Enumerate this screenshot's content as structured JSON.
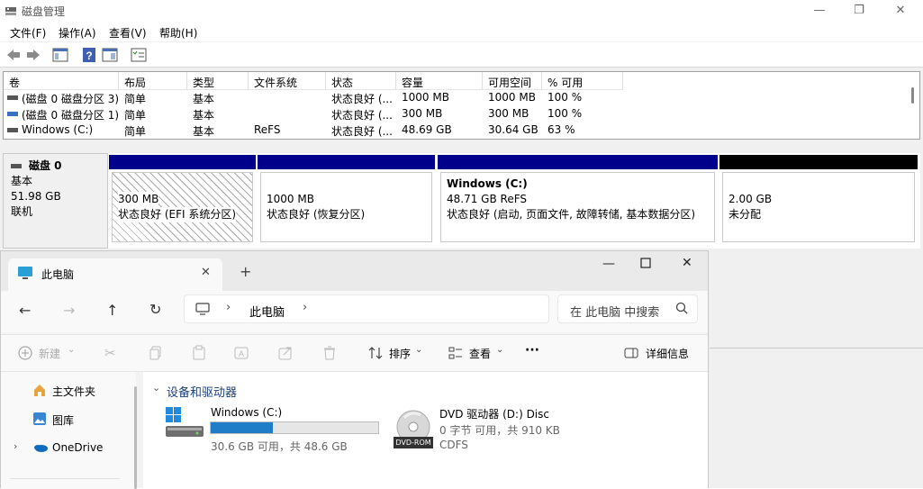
{
  "disk_mgmt": {
    "title": "磁盘管理",
    "menu": [
      "文件(F)",
      "操作(A)",
      "查看(V)",
      "帮助(H)"
    ],
    "columns": [
      "卷",
      "布局",
      "类型",
      "文件系统",
      "状态",
      "容量",
      "可用空间",
      "% 可用"
    ],
    "rows": [
      [
        "(磁盘 0 磁盘分区 3)",
        "简单",
        "基本",
        "",
        "状态良好 (...",
        "1000 MB",
        "1000 MB",
        "100 %"
      ],
      [
        "(磁盘 0 磁盘分区 1)",
        "简单",
        "基本",
        "",
        "状态良好 (...",
        "300 MB",
        "300 MB",
        "100 %"
      ],
      [
        "Windows (C:)",
        "简单",
        "基本",
        "ReFS",
        "状态良好 (...",
        "48.69 GB",
        "30.64 GB",
        "63 %"
      ]
    ],
    "disk": {
      "name": "磁盘 0",
      "type": "基本",
      "size": "51.98 GB",
      "status": "联机"
    },
    "partitions": [
      {
        "name": "",
        "size": "300 MB",
        "status": "状态良好 (EFI 系统分区)"
      },
      {
        "name": "",
        "size": "1000 MB",
        "status": "状态良好 (恢复分区)"
      },
      {
        "name": "Windows  (C:)",
        "size": "48.71 GB ReFS",
        "status": "状态良好 (启动, 页面文件, 故障转储, 基本数据分区)"
      },
      {
        "name": "",
        "size": "2.00 GB",
        "status": "未分配"
      }
    ],
    "colors": {
      "primary_bar": "#00008b",
      "unallocated_bar": "#000000"
    }
  },
  "explorer": {
    "tab_title": "此电脑",
    "add_tab": "+",
    "breadcrumb": "此电脑",
    "search_placeholder": "在 此电脑 中搜索",
    "commands": {
      "new": "新建",
      "sort": "排序",
      "view": "查看",
      "more": "···",
      "details": "详细信息"
    },
    "nav": [
      {
        "label": "主文件夹",
        "icon": "home-icon"
      },
      {
        "label": "图库",
        "icon": "gallery-icon"
      },
      {
        "label": "OneDrive",
        "icon": "cloud-icon"
      }
    ],
    "section_title": "设备和驱动器",
    "drives": [
      {
        "name": "Windows (C:)",
        "info": "30.6 GB 可用，共 48.6 GB",
        "used_fraction": 0.37,
        "icon": "windows-drive-icon"
      },
      {
        "name": "DVD 驱动器 (D:) Disc",
        "info": "0 字节 可用，共 910 KB",
        "fs": "CDFS",
        "badge": "DVD-ROM",
        "icon": "dvd-drive-icon"
      }
    ],
    "colors": {
      "accent": "#1f7dc8"
    }
  }
}
